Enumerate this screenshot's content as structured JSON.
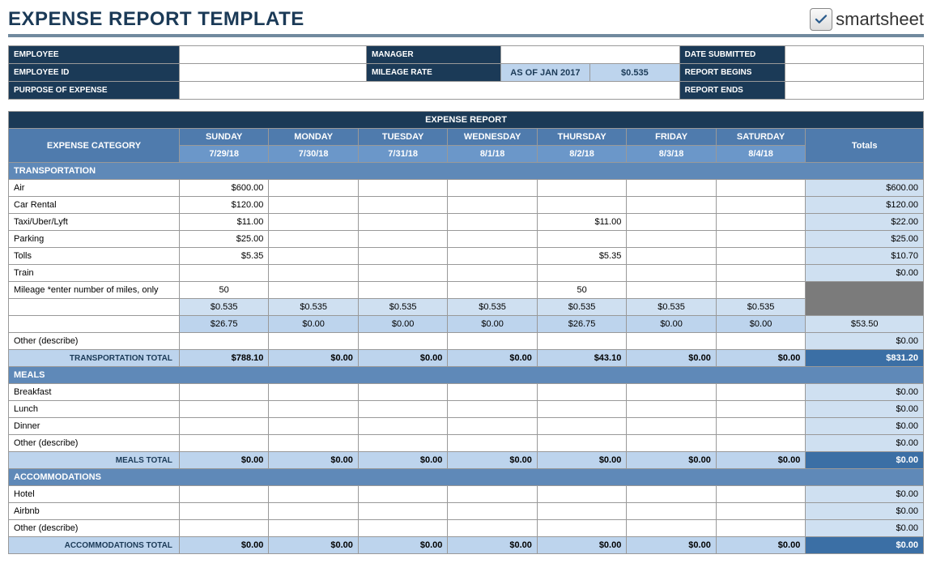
{
  "header": {
    "title": "EXPENSE REPORT TEMPLATE",
    "logo_text": "smartsheet"
  },
  "info": {
    "employee_label": "EMPLOYEE",
    "employee_value": "",
    "manager_label": "MANAGER",
    "manager_value": "",
    "date_submitted_label": "DATE SUBMITTED",
    "date_submitted_value": "",
    "employee_id_label": "EMPLOYEE ID",
    "employee_id_value": "",
    "mileage_rate_label": "MILEAGE RATE",
    "mileage_rate_note": "AS OF JAN 2017",
    "mileage_rate_value": "$0.535",
    "report_begins_label": "REPORT BEGINS",
    "report_begins_value": "",
    "purpose_label": "PURPOSE OF EXPENSE",
    "purpose_value": "",
    "report_ends_label": "REPORT ENDS",
    "report_ends_value": ""
  },
  "table": {
    "report_title": "EXPENSE REPORT",
    "category_header": "EXPENSE CATEGORY",
    "totals_header": "Totals",
    "days": [
      "SUNDAY",
      "MONDAY",
      "TUESDAY",
      "WEDNESDAY",
      "THURSDAY",
      "FRIDAY",
      "SATURDAY"
    ],
    "dates": [
      "7/29/18",
      "7/30/18",
      "7/31/18",
      "8/1/18",
      "8/2/18",
      "8/3/18",
      "8/4/18"
    ],
    "sections": {
      "transportation": {
        "title": "TRANSPORTATION",
        "rows": [
          {
            "label": "Air",
            "vals": [
              "$600.00",
              "",
              "",
              "",
              "",
              "",
              ""
            ],
            "total": "$600.00"
          },
          {
            "label": "Car Rental",
            "vals": [
              "$120.00",
              "",
              "",
              "",
              "",
              "",
              ""
            ],
            "total": "$120.00"
          },
          {
            "label": "Taxi/Uber/Lyft",
            "vals": [
              "$11.00",
              "",
              "",
              "",
              "$11.00",
              "",
              ""
            ],
            "total": "$22.00"
          },
          {
            "label": "Parking",
            "vals": [
              "$25.00",
              "",
              "",
              "",
              "",
              "",
              ""
            ],
            "total": "$25.00"
          },
          {
            "label": "Tolls",
            "vals": [
              "$5.35",
              "",
              "",
              "",
              "$5.35",
              "",
              ""
            ],
            "total": "$10.70"
          },
          {
            "label": "Train",
            "vals": [
              "",
              "",
              "",
              "",
              "",
              "",
              ""
            ],
            "total": "$0.00"
          }
        ],
        "mileage_label": "Mileage *enter number of miles, only",
        "mileage_count": [
          "50",
          "",
          "",
          "",
          "50",
          "",
          ""
        ],
        "mileage_rate": [
          "$0.535",
          "$0.535",
          "$0.535",
          "$0.535",
          "$0.535",
          "$0.535",
          "$0.535"
        ],
        "mileage_cost": [
          "$26.75",
          "$0.00",
          "$0.00",
          "$0.00",
          "$26.75",
          "$0.00",
          "$0.00"
        ],
        "mileage_total": "$53.50",
        "other_label": "Other (describe)",
        "other_total": "$0.00",
        "subtotal_label": "TRANSPORTATION TOTAL",
        "subtotal_vals": [
          "$788.10",
          "$0.00",
          "$0.00",
          "$0.00",
          "$43.10",
          "$0.00",
          "$0.00"
        ],
        "subtotal_total": "$831.20"
      },
      "meals": {
        "title": "MEALS",
        "rows": [
          {
            "label": "Breakfast",
            "vals": [
              "",
              "",
              "",
              "",
              "",
              "",
              ""
            ],
            "total": "$0.00"
          },
          {
            "label": "Lunch",
            "vals": [
              "",
              "",
              "",
              "",
              "",
              "",
              ""
            ],
            "total": "$0.00"
          },
          {
            "label": "Dinner",
            "vals": [
              "",
              "",
              "",
              "",
              "",
              "",
              ""
            ],
            "total": "$0.00"
          },
          {
            "label": "Other (describe)",
            "vals": [
              "",
              "",
              "",
              "",
              "",
              "",
              ""
            ],
            "total": "$0.00"
          }
        ],
        "subtotal_label": "MEALS TOTAL",
        "subtotal_vals": [
          "$0.00",
          "$0.00",
          "$0.00",
          "$0.00",
          "$0.00",
          "$0.00",
          "$0.00"
        ],
        "subtotal_total": "$0.00"
      },
      "accommodations": {
        "title": "ACCOMMODATIONS",
        "rows": [
          {
            "label": "Hotel",
            "vals": [
              "",
              "",
              "",
              "",
              "",
              "",
              ""
            ],
            "total": "$0.00"
          },
          {
            "label": "Airbnb",
            "vals": [
              "",
              "",
              "",
              "",
              "",
              "",
              ""
            ],
            "total": "$0.00"
          },
          {
            "label": "Other (describe)",
            "vals": [
              "",
              "",
              "",
              "",
              "",
              "",
              ""
            ],
            "total": "$0.00"
          }
        ],
        "subtotal_label": "ACCOMMODATIONS TOTAL",
        "subtotal_vals": [
          "$0.00",
          "$0.00",
          "$0.00",
          "$0.00",
          "$0.00",
          "$0.00",
          "$0.00"
        ],
        "subtotal_total": "$0.00"
      }
    }
  }
}
